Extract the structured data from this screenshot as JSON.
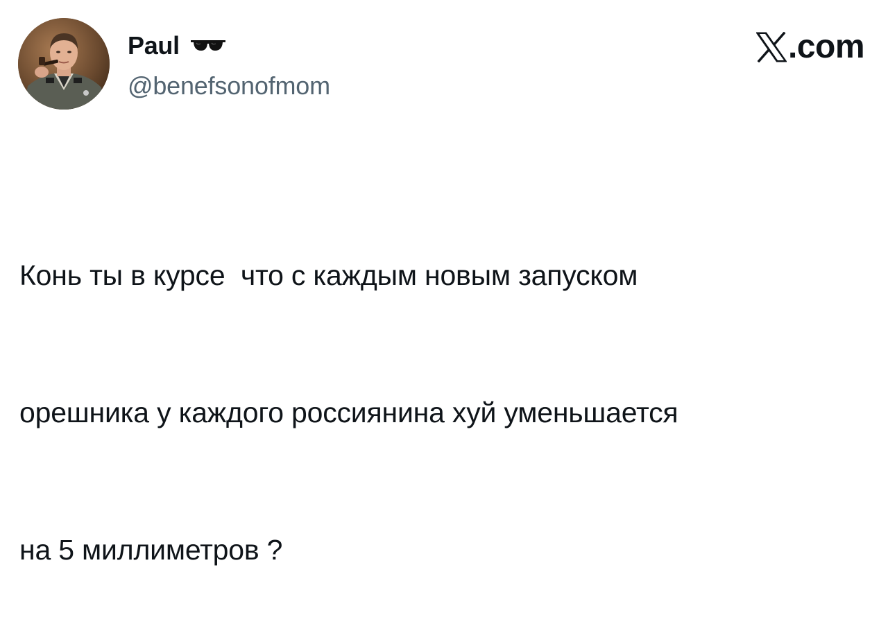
{
  "author": {
    "display_name": "Paul",
    "handle": "@benefsonofmom",
    "name_emoji_icon": "sunglasses-icon",
    "avatar_icon": "profile-photo"
  },
  "brand": {
    "logo_icon": "x-logo-icon",
    "domain": ".com"
  },
  "tweet": {
    "lines": [
      "Конь ты в курсе  что с каждым новым запуском",
      "орешника у каждого россиянина хуй уменьшается",
      "на 5 миллиметров ?"
    ]
  },
  "colors": {
    "text": "#0f1419",
    "secondary_text": "#536471",
    "background": "#ffffff"
  }
}
